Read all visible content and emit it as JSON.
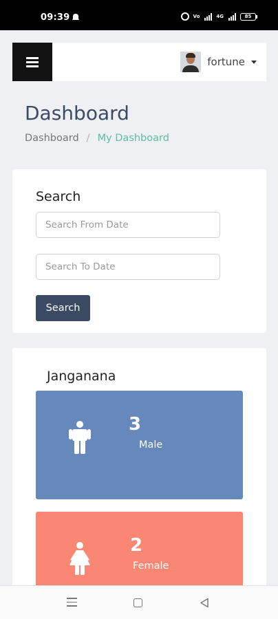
{
  "status_bar": {
    "time": "09:39",
    "signal_labels": [
      "4G",
      "Vo"
    ],
    "battery": "85"
  },
  "topnav": {
    "username": "fortune"
  },
  "page": {
    "title": "Dashboard",
    "breadcrumb": {
      "root": "Dashboard",
      "separator": "/",
      "current": "My Dashboard"
    }
  },
  "search": {
    "heading": "Search",
    "from_placeholder": "Search From Date",
    "to_placeholder": "Search To Date",
    "button_label": "Search"
  },
  "stats": {
    "heading": "Janganana",
    "male": {
      "count": "3",
      "label": "Male",
      "color": "#6788bb",
      "icon": "male-icon"
    },
    "female": {
      "count": "2",
      "label": "Female",
      "color": "#fa8674",
      "icon": "female-icon"
    }
  },
  "colors": {
    "breadcrumb_current": "#5cbf9a",
    "search_button": "#3a4a62",
    "menu_button": "#121212"
  }
}
